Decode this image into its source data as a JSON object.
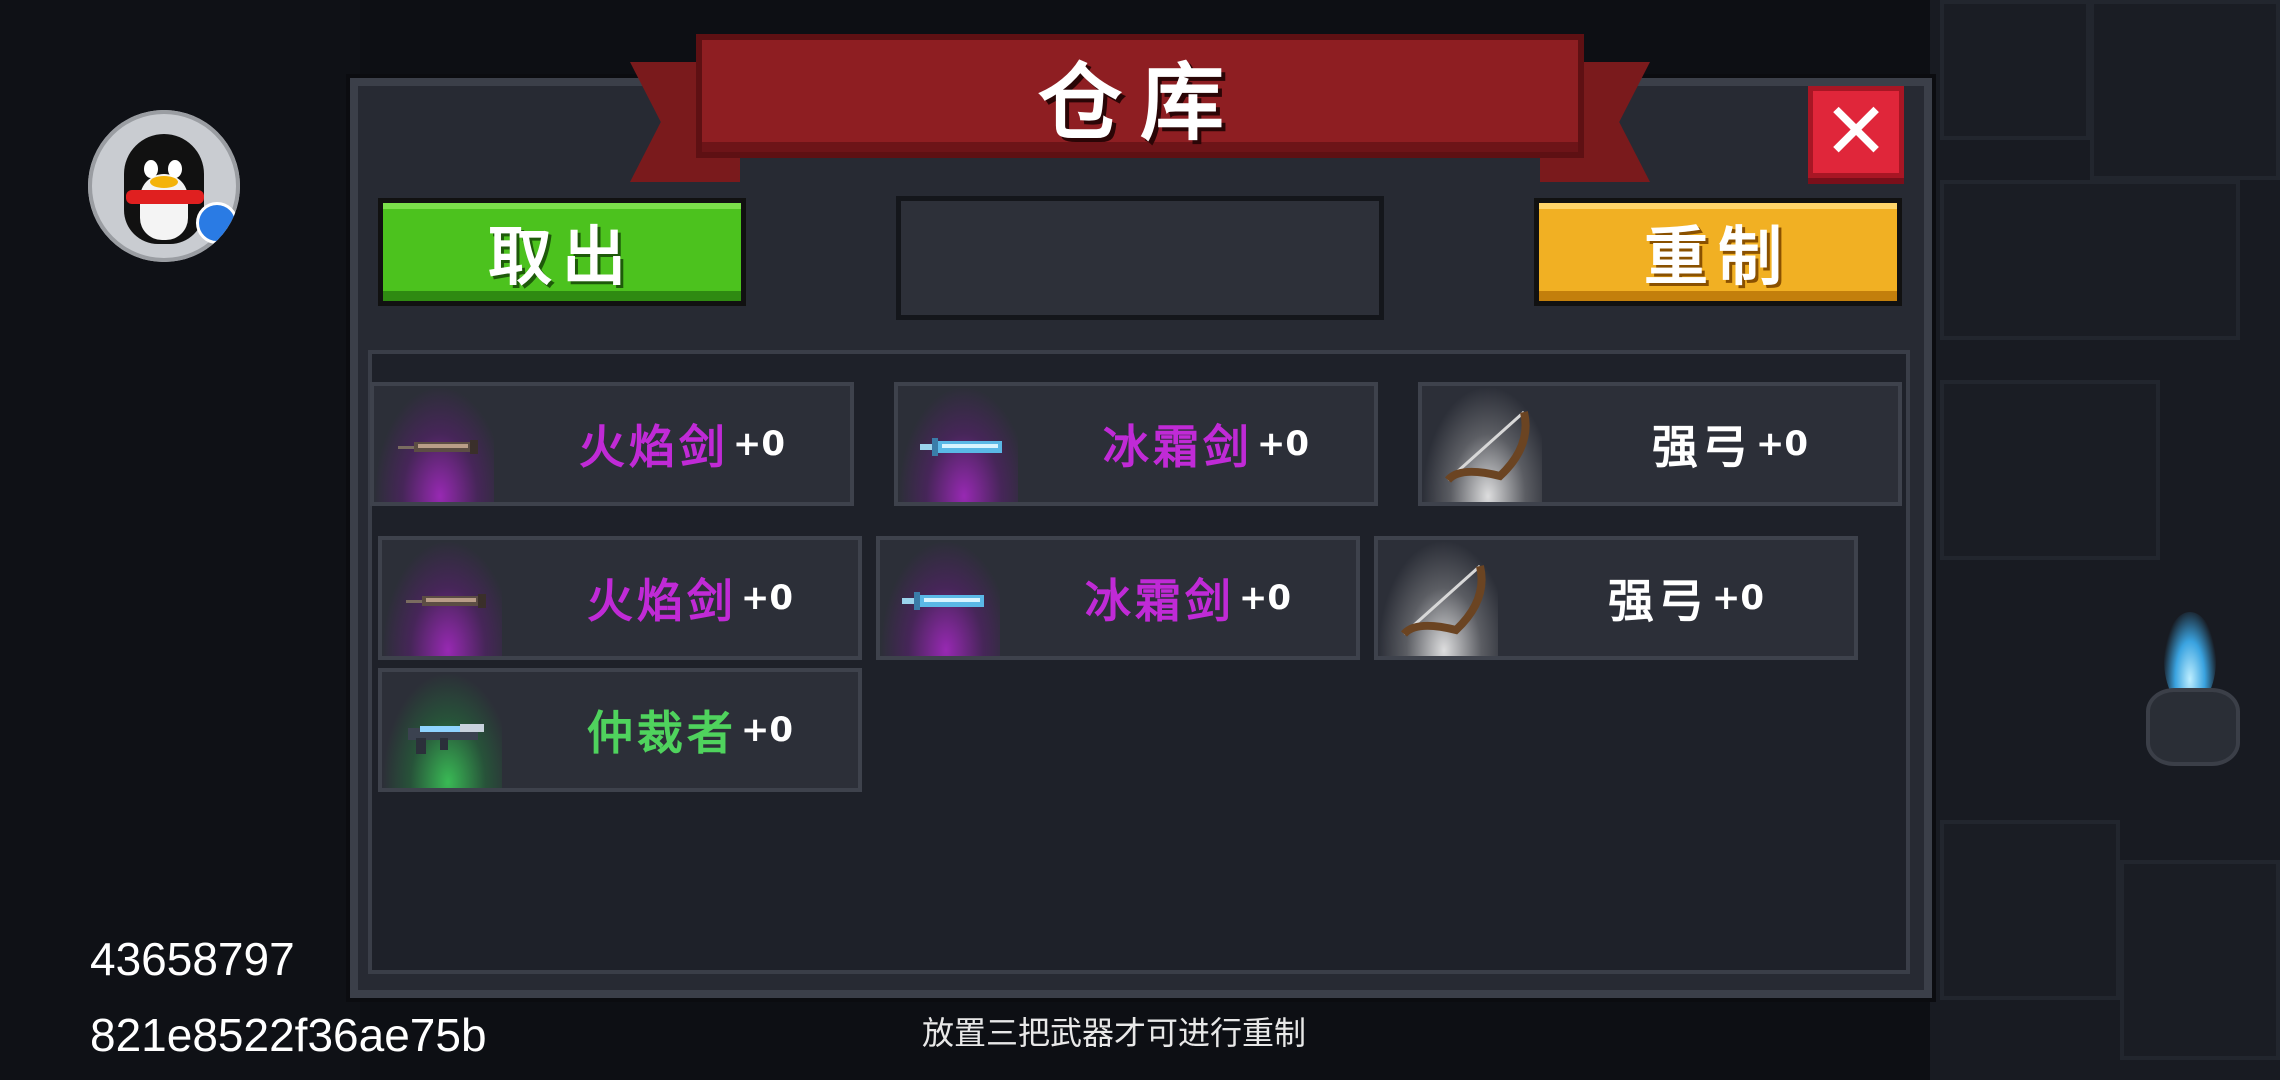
{
  "title": "仓库",
  "buttons": {
    "take_out": "取出",
    "remake": "重制",
    "close": "✕"
  },
  "remake_slot": {
    "label": ""
  },
  "top_row": [
    {
      "name": "火焰剑",
      "plus": "+0",
      "rarity_color": "#c02ad6",
      "icon": "flame-sword-icon"
    },
    {
      "name": "冰霜剑",
      "plus": "+0",
      "rarity_color": "#c02ad6",
      "icon": "frost-sword-icon"
    },
    {
      "name": "强弓",
      "plus": "+0",
      "rarity_color": "#ffffff",
      "icon": "bow-icon"
    }
  ],
  "inventory": [
    {
      "name": "火焰剑",
      "plus": "+0",
      "rarity_color": "#c02ad6",
      "icon": "flame-sword-icon"
    },
    {
      "name": "冰霜剑",
      "plus": "+0",
      "rarity_color": "#c02ad6",
      "icon": "frost-sword-icon"
    },
    {
      "name": "强弓",
      "plus": "+0",
      "rarity_color": "#ffffff",
      "icon": "bow-icon"
    },
    {
      "name": "仲裁者",
      "plus": "+0",
      "rarity_color": "#4fd35d",
      "icon": "arbiter-gun-icon"
    }
  ],
  "hint": "放置三把武器才可进行重制",
  "overlay": {
    "id_number": "43658797",
    "id_hash": "821e8522f36ae75b"
  },
  "colors": {
    "ribbon": "#8e1e22",
    "take_button": "#4cc21e",
    "remake_button": "#f1b023",
    "close_button": "#e0263a"
  }
}
